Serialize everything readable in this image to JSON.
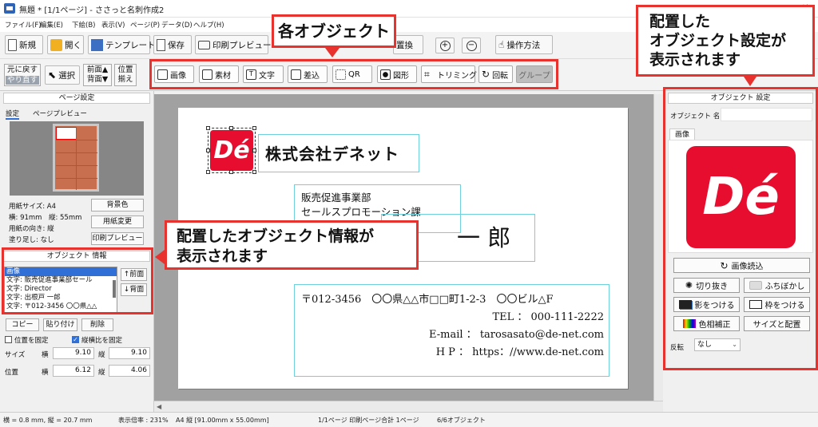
{
  "window": {
    "title": "無題 * [1/1ページ] - ささっと名刺作成2",
    "minimize": "—",
    "close": "✕"
  },
  "menu": [
    "ファイル(F)",
    "編集(E)",
    "下絵(B)",
    "表示(V)",
    "ページ(P)",
    "データ(D)",
    "ヘルプ(H)"
  ],
  "toolbar": {
    "new": "新規",
    "open": "開く",
    "template": "テンプレート",
    "save": "保存",
    "print_preview": "印刷プレビュー",
    "replace": "置換",
    "howto": "操作方法"
  },
  "edit_tools": {
    "undo": "元に戻す",
    "redo": "やり直す",
    "select": "選択",
    "front": "前面▲",
    "back": "背面▼",
    "align_line1": "位置",
    "align_line2": "揃え"
  },
  "object_buttons": [
    "画像",
    "素材",
    "文字",
    "差込",
    "QR",
    "図形",
    "トリミング",
    "回転",
    "グループ"
  ],
  "callouts": {
    "objects": "各オブジェクト",
    "settings": "配置した\nオブジェクト設定が\n表示されます",
    "info": "配置したオブジェクト情報が\n表示されます"
  },
  "page_settings": {
    "header": "ページ設定",
    "tabs": [
      "設定",
      "ページプレビュー"
    ],
    "paper_size": "用紙サイズ: A4",
    "dimensions": "横: 91mm　縦: 55mm",
    "orientation": "用紙の向き: 縦",
    "bleed": "塗り足し: なし",
    "bg_color_btn": "背景色",
    "paper_change_btn": "用紙変更",
    "print_preview_btn": "印刷プレビュー"
  },
  "object_info": {
    "header": "オブジェクト 情報",
    "items": [
      "画像",
      "文字: 販売促進事業部セール",
      "文字: Director",
      "文字: 出根戸 一郎",
      "文字: 〒012-3456 〇〇県△△"
    ],
    "front_btn": "↑前面",
    "back_btn": "↓背面",
    "copy": "コピー",
    "paste": "貼り付け",
    "delete": "削除",
    "fix_position": "位置を固定",
    "fix_ratio": "縦横比を固定",
    "size_label": "サイズ",
    "pos_label": "位置",
    "w_label": "横",
    "h_label": "縦",
    "size_w": "9.10",
    "size_h": "9.10",
    "pos_x": "6.12",
    "pos_y": "4.06"
  },
  "card": {
    "company": "株式会社デネット",
    "dept1": "販売促進事業部",
    "dept2": "セールスプロモーション課",
    "name_part1": "戸",
    "name_part2": "一 郎",
    "address": "〒012-3456　〇〇県△△市□□町1-2-3　〇〇ビル△F",
    "tel": "TEL ： 000-111-2222",
    "email": "E-mail ： tarosasato@de-net.com",
    "hp": "H P ： https：//www.de-net.com"
  },
  "logo": {
    "text": "Dé",
    "color": "#e60d2e"
  },
  "object_settings": {
    "header": "オブジェクト 設定",
    "name_label": "オブジェクト 名",
    "name_value": "",
    "tab": "画像",
    "load_btn": "画像読込",
    "buttons": [
      "切り抜き",
      "ふちぼかし",
      "影をつける",
      "枠をつける",
      "色相補正",
      "サイズと配置"
    ],
    "flip_label": "反転",
    "flip_value": "なし"
  },
  "status": {
    "cursor": "横 = 0.8 mm, 縦 = 20.7 mm",
    "zoom": "表示倍率 : 231%",
    "paper": "A4 縦 [91.00mm x 55.00mm]",
    "pages": "1/1ページ 印刷ページ合計 1ページ",
    "objects": "6/6オブジェクト"
  },
  "colors": {
    "accent_red": "#e8322d",
    "guide": "#6fd1dc",
    "selection": "#2f6fd6"
  }
}
